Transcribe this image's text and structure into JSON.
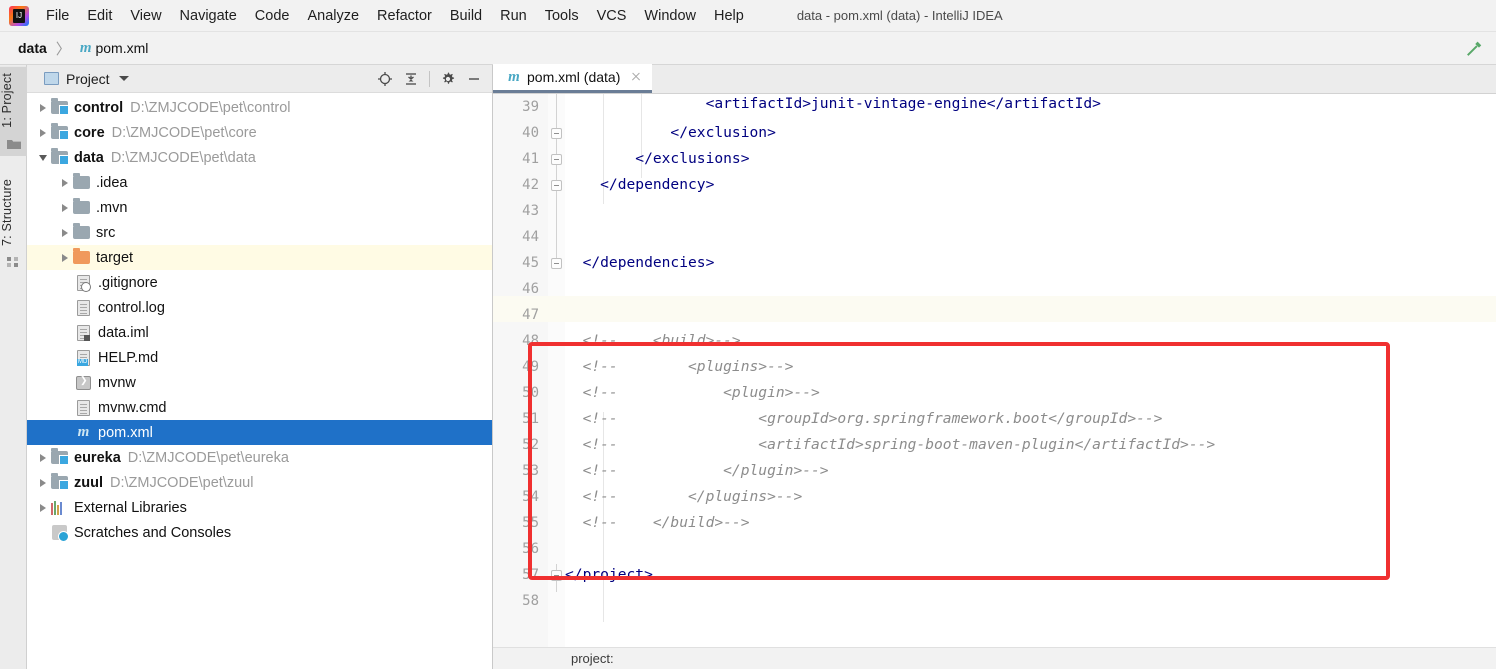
{
  "window": {
    "title": "data - pom.xml (data) - IntelliJ IDEA",
    "logo_icon": "intellij-idea-logo"
  },
  "menubar": {
    "items": [
      {
        "label": "File"
      },
      {
        "label": "Edit"
      },
      {
        "label": "View"
      },
      {
        "label": "Navigate"
      },
      {
        "label": "Code"
      },
      {
        "label": "Analyze"
      },
      {
        "label": "Refactor"
      },
      {
        "label": "Build"
      },
      {
        "label": "Run"
      },
      {
        "label": "Tools"
      },
      {
        "label": "VCS"
      },
      {
        "label": "Window"
      },
      {
        "label": "Help"
      }
    ]
  },
  "navbar": {
    "crumb_project": "data",
    "separator": "〉",
    "crumb_file_icon": "maven-m-icon",
    "crumb_file": "pom.xml",
    "right_icon": "hammer-icon"
  },
  "tool_tabs": [
    {
      "label": "1: Project",
      "icon": "folder-icon",
      "active": true
    },
    {
      "label": "7: Structure",
      "icon": "structure-icon",
      "active": false
    }
  ],
  "project_panel": {
    "title": "Project",
    "title_icon": "project-view-icon",
    "dropdown_icon": "chevron-down-icon",
    "tools": [
      {
        "name": "locate-icon",
        "glyph": "scope-target"
      },
      {
        "name": "collapse-all-icon",
        "glyph": "collapse"
      },
      {
        "name": "settings-gear-icon",
        "glyph": "gear"
      },
      {
        "name": "hide-panel-icon",
        "glyph": "minus"
      }
    ],
    "tree": [
      {
        "label": "control",
        "path": "D:\\ZMJCODE\\pet\\control",
        "icon": "module-folder-icon",
        "arrow": "right",
        "indent": 0,
        "bold": true
      },
      {
        "label": "core",
        "path": "D:\\ZMJCODE\\pet\\core",
        "icon": "module-folder-icon",
        "arrow": "right",
        "indent": 0,
        "bold": true
      },
      {
        "label": "data",
        "path": "D:\\ZMJCODE\\pet\\data",
        "icon": "module-folder-icon",
        "arrow": "down",
        "indent": 0,
        "bold": true
      },
      {
        "label": ".idea",
        "path": "",
        "icon": "folder-icon",
        "arrow": "right",
        "indent": 1,
        "bold": false
      },
      {
        "label": ".mvn",
        "path": "",
        "icon": "folder-icon",
        "arrow": "right",
        "indent": 1,
        "bold": false
      },
      {
        "label": "src",
        "path": "",
        "icon": "folder-icon",
        "arrow": "right",
        "indent": 1,
        "bold": false
      },
      {
        "label": "target",
        "path": "",
        "icon": "excluded-folder-icon",
        "arrow": "right",
        "indent": 1,
        "bold": false,
        "highlight": true
      },
      {
        "label": ".gitignore",
        "path": "",
        "icon": "gitignore-file-icon",
        "arrow": "none",
        "indent": 2,
        "bold": false
      },
      {
        "label": "control.log",
        "path": "",
        "icon": "log-file-icon",
        "arrow": "none",
        "indent": 2,
        "bold": false
      },
      {
        "label": "data.iml",
        "path": "",
        "icon": "iml-file-icon",
        "arrow": "none",
        "indent": 2,
        "bold": false
      },
      {
        "label": "HELP.md",
        "path": "",
        "icon": "markdown-file-icon",
        "arrow": "none",
        "indent": 2,
        "bold": false
      },
      {
        "label": "mvnw",
        "path": "",
        "icon": "shell-script-icon",
        "arrow": "none",
        "indent": 2,
        "bold": false
      },
      {
        "label": "mvnw.cmd",
        "path": "",
        "icon": "cmd-file-icon",
        "arrow": "none",
        "indent": 2,
        "bold": false
      },
      {
        "label": "pom.xml",
        "path": "",
        "icon": "maven-pom-icon",
        "arrow": "none",
        "indent": 2,
        "bold": false,
        "selected": true
      },
      {
        "label": "eureka",
        "path": "D:\\ZMJCODE\\pet\\eureka",
        "icon": "module-folder-icon",
        "arrow": "right",
        "indent": 0,
        "bold": true
      },
      {
        "label": "zuul",
        "path": "D:\\ZMJCODE\\pet\\zuul",
        "icon": "module-folder-icon",
        "arrow": "right",
        "indent": 0,
        "bold": true
      },
      {
        "label": "External Libraries",
        "path": "",
        "icon": "libraries-icon",
        "arrow": "right",
        "indent": 0,
        "bold": false
      },
      {
        "label": "Scratches and Consoles",
        "path": "",
        "icon": "scratches-icon",
        "arrow": "none",
        "indent": 0,
        "bold": false
      }
    ]
  },
  "editor": {
    "tab": {
      "label": "pom.xml (data)",
      "icon": "maven-pom-icon",
      "close_icon": "close-icon"
    },
    "first_visible_line": 39,
    "caret_line": 47,
    "bottom_breadcrumb": "project:",
    "lines": [
      {
        "n": 39,
        "indent": 0,
        "code": "                <artifactId>junit-vintage-engine</artifactId>",
        "kind": "tag",
        "fold": false,
        "clipped": true
      },
      {
        "n": 40,
        "indent": 0,
        "code": "            </exclusion>",
        "kind": "tag",
        "fold": true
      },
      {
        "n": 41,
        "indent": 0,
        "code": "        </exclusions>",
        "kind": "tag",
        "fold": true
      },
      {
        "n": 42,
        "indent": 0,
        "code": "    </dependency>",
        "kind": "tag",
        "fold": true
      },
      {
        "n": 43,
        "indent": 0,
        "code": "",
        "kind": "tag",
        "fold": false
      },
      {
        "n": 44,
        "indent": 0,
        "code": "",
        "kind": "tag",
        "fold": false
      },
      {
        "n": 45,
        "indent": 0,
        "code": "  </dependencies>",
        "kind": "tag",
        "fold": true
      },
      {
        "n": 46,
        "indent": 0,
        "code": "",
        "kind": "tag",
        "fold": false
      },
      {
        "n": 47,
        "indent": 0,
        "code": "",
        "kind": "tag",
        "fold": false
      },
      {
        "n": 48,
        "indent": 0,
        "code": "  <!--    <build>-->",
        "kind": "cmt",
        "fold": false
      },
      {
        "n": 49,
        "indent": 0,
        "code": "  <!--        <plugins>-->",
        "kind": "cmt",
        "fold": false
      },
      {
        "n": 50,
        "indent": 0,
        "code": "  <!--            <plugin>-->",
        "kind": "cmt",
        "fold": false
      },
      {
        "n": 51,
        "indent": 0,
        "code": "  <!--                <groupId>org.springframework.boot</groupId>-->",
        "kind": "cmt",
        "fold": false
      },
      {
        "n": 52,
        "indent": 0,
        "code": "  <!--                <artifactId>spring-boot-maven-plugin</artifactId>-->",
        "kind": "cmt",
        "fold": false
      },
      {
        "n": 53,
        "indent": 0,
        "code": "  <!--            </plugin>-->",
        "kind": "cmt",
        "fold": false
      },
      {
        "n": 54,
        "indent": 0,
        "code": "  <!--        </plugins>-->",
        "kind": "cmt",
        "fold": false
      },
      {
        "n": 55,
        "indent": 0,
        "code": "  <!--    </build>-->",
        "kind": "cmt",
        "fold": false
      },
      {
        "n": 56,
        "indent": 0,
        "code": "",
        "kind": "tag",
        "fold": false
      },
      {
        "n": 57,
        "indent": 0,
        "code": "</project>",
        "kind": "tag",
        "fold": true
      },
      {
        "n": 58,
        "indent": 0,
        "code": "",
        "kind": "tag",
        "fold": false
      }
    ],
    "annotation": {
      "name": "red-highlight-rectangle",
      "color": "#f03030"
    }
  },
  "colors": {
    "selection_blue": "#1f71c8",
    "tag_navy": "#000080",
    "comment_gray": "#8c8c8c",
    "annotation_red": "#f03030",
    "highlight_yellow": "#fffbe4"
  }
}
